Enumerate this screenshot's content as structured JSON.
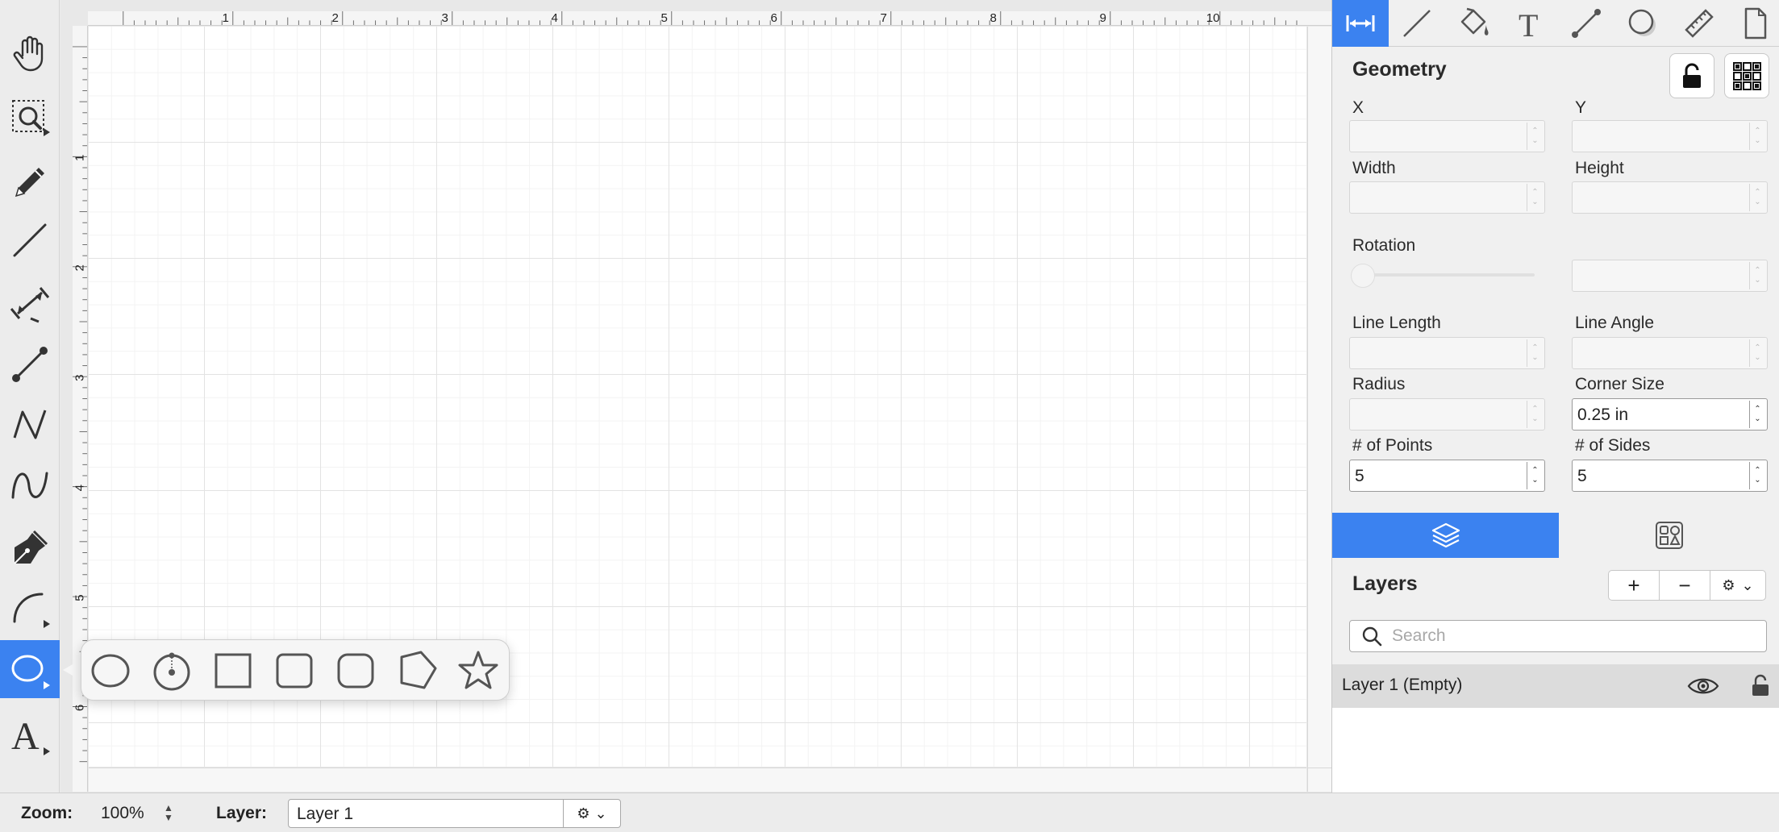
{
  "toolbar": {
    "tools": [
      "hand-tool",
      "zoom-tool",
      "pencil-tool",
      "line-tool",
      "dimension-tool",
      "connector-tool",
      "polyline-tool",
      "curve-tool",
      "pen-tool",
      "arc-tool",
      "shape-tool",
      "text-tool"
    ],
    "active": "shape-tool"
  },
  "rulers": {
    "top": [
      "1",
      "2",
      "3",
      "4",
      "5",
      "6",
      "7",
      "8",
      "9",
      "10"
    ],
    "left": [
      "1",
      "2",
      "3",
      "4",
      "5",
      "6"
    ]
  },
  "shape_popover": {
    "shapes": [
      "ellipse",
      "circle-from-center",
      "rectangle",
      "rounded-rectangle",
      "rounded-square",
      "polygon",
      "star"
    ]
  },
  "inspector": {
    "tabs": [
      "geometry-tab",
      "line-tab",
      "fill-tab",
      "text-tab",
      "connector-tab",
      "shadow-tab",
      "measure-tab",
      "document-tab"
    ],
    "active_tab": "geometry-tab",
    "section_title": "Geometry",
    "fields": {
      "x": {
        "label": "X",
        "value": ""
      },
      "y": {
        "label": "Y",
        "value": ""
      },
      "width": {
        "label": "Width",
        "value": ""
      },
      "height": {
        "label": "Height",
        "value": ""
      },
      "rotation": {
        "label": "Rotation",
        "value": ""
      },
      "line_length": {
        "label": "Line Length",
        "value": ""
      },
      "line_angle": {
        "label": "Line Angle",
        "value": ""
      },
      "radius": {
        "label": "Radius",
        "value": ""
      },
      "corner_size": {
        "label": "Corner Size",
        "value": "0.25 in"
      },
      "points": {
        "label": "# of Points",
        "value": "5"
      },
      "sides": {
        "label": "# of Sides",
        "value": "5"
      }
    }
  },
  "layers": {
    "title": "Layers",
    "add_label": "+",
    "remove_label": "−",
    "search_placeholder": "Search",
    "items": [
      {
        "name": "Layer 1 (Empty)"
      }
    ]
  },
  "statusbar": {
    "zoom_label": "Zoom:",
    "zoom_value": "100%",
    "layer_label": "Layer:",
    "layer_value": "Layer 1"
  },
  "colors": {
    "accent": "#3b82f0"
  }
}
